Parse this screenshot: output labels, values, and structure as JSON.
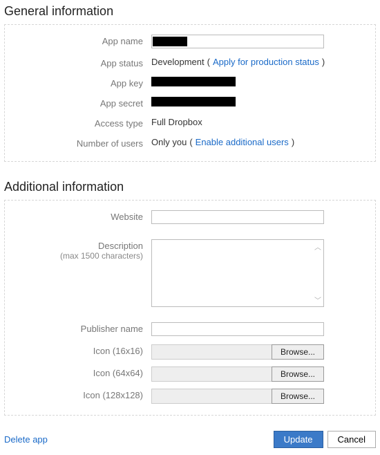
{
  "general": {
    "title": "General information",
    "app_name": {
      "label": "App name",
      "value": ""
    },
    "app_status": {
      "label": "App status",
      "value": "Development",
      "link_text": "Apply for production status"
    },
    "app_key": {
      "label": "App key"
    },
    "app_secret": {
      "label": "App secret"
    },
    "access_type": {
      "label": "Access type",
      "value": "Full Dropbox"
    },
    "users": {
      "label": "Number of users",
      "value": "Only you",
      "link_text": "Enable additional users"
    }
  },
  "additional": {
    "title": "Additional information",
    "website": {
      "label": "Website",
      "value": ""
    },
    "description": {
      "label": "Description",
      "sublabel": "(max 1500 characters)",
      "value": ""
    },
    "publisher": {
      "label": "Publisher name",
      "value": ""
    },
    "icon16": {
      "label": "Icon (16x16)",
      "browse": "Browse..."
    },
    "icon64": {
      "label": "Icon (64x64)",
      "browse": "Browse..."
    },
    "icon128": {
      "label": "Icon (128x128)",
      "browse": "Browse..."
    }
  },
  "footer": {
    "delete": "Delete app",
    "update": "Update",
    "cancel": "Cancel"
  }
}
